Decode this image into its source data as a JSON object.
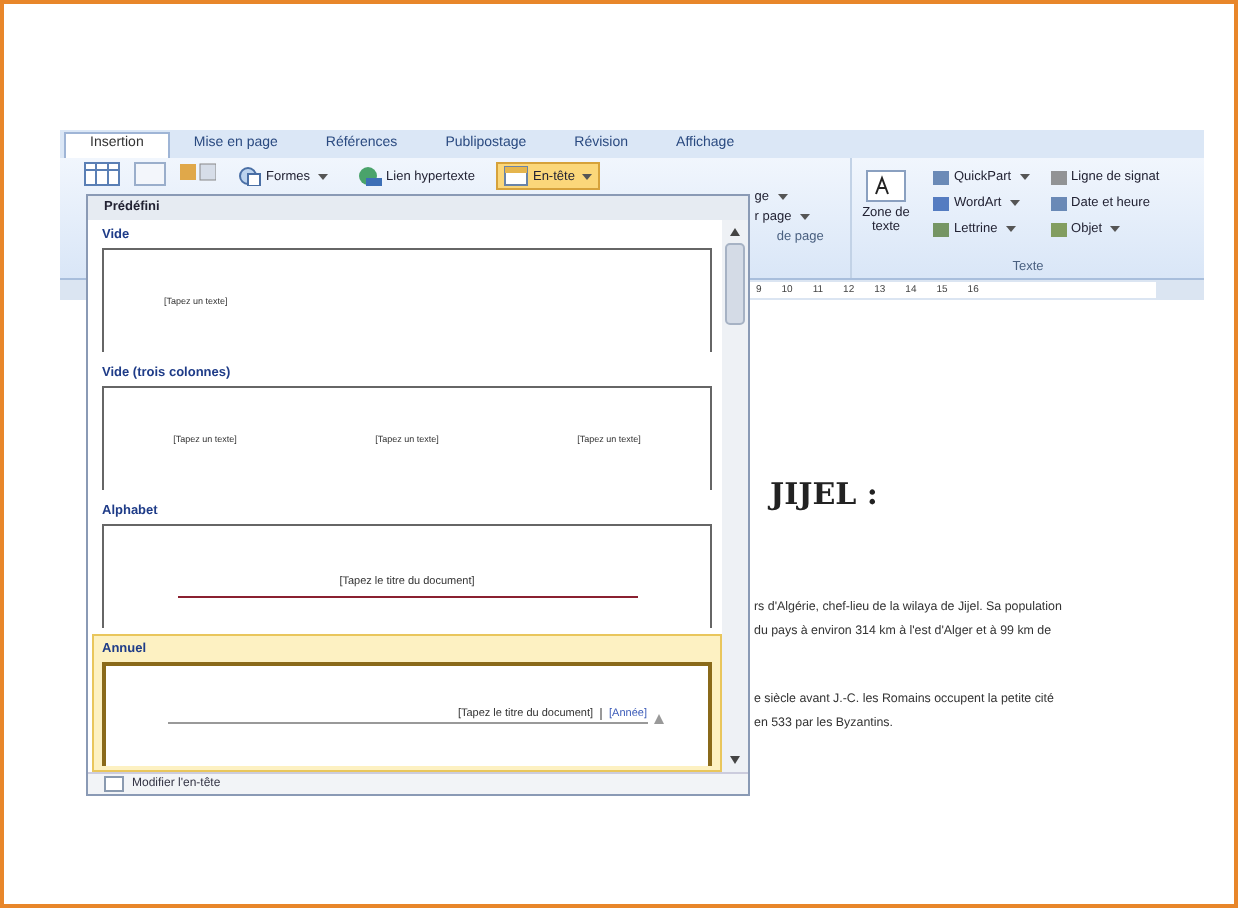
{
  "tabs": [
    {
      "label": "Insertion",
      "selected": true
    },
    {
      "label": "Mise en page",
      "selected": false
    },
    {
      "label": "Références",
      "selected": false
    },
    {
      "label": "Publipostage",
      "selected": false
    },
    {
      "label": "Révision",
      "selected": false
    },
    {
      "label": "Affichage",
      "selected": false
    }
  ],
  "ribbon": {
    "top_buttons": [
      {
        "label": "Formes",
        "has_menu": true,
        "selected": false
      },
      {
        "label": "Lien hypertexte",
        "has_menu": false,
        "selected": false
      },
      {
        "label": "En-tête",
        "has_menu": true,
        "selected": true
      }
    ],
    "cut_items": [
      {
        "label": "ge",
        "has_menu": true
      },
      {
        "label": "r page",
        "has_menu": true
      }
    ],
    "cut_group_label": "de page",
    "text_group": {
      "label": "Texte",
      "big_button": "Zone de texte",
      "items": [
        {
          "label": "QuickPart",
          "has_menu": true
        },
        {
          "label": "WordArt",
          "has_menu": true
        },
        {
          "label": "Lettrine",
          "has_menu": true
        },
        {
          "label": "Ligne de signat",
          "has_menu": false
        },
        {
          "label": "Date et heure",
          "has_menu": false
        },
        {
          "label": "Objet",
          "has_menu": true
        }
      ]
    }
  },
  "ruler": {
    "ticks": [
      "9",
      "10",
      "11",
      "12",
      "13",
      "14",
      "15",
      "16"
    ]
  },
  "gallery": {
    "title": "Prédéfini",
    "sections": [
      {
        "label": "Vide",
        "kind": "blank",
        "selected": false,
        "placeholders": [
          "[Tapez un texte]"
        ]
      },
      {
        "label": "Vide (trois colonnes)",
        "kind": "blank",
        "selected": false,
        "placeholders": [
          "[Tapez un texte]",
          "[Tapez un texte]",
          "[Tapez un texte]"
        ]
      },
      {
        "label": "Alphabet",
        "kind": "title_rule",
        "selected": false,
        "title": "[Tapez le titre du document]"
      },
      {
        "label": "Annuel",
        "kind": "title_year",
        "selected": true,
        "title": "[Tapez le titre du document]",
        "year": "[Année]"
      }
    ],
    "footer": "Modifier l'en-tête"
  },
  "document": {
    "heading": "JIJEL :",
    "paragraphs": [
      [
        "rs d'Algérie, chef-lieu de la wilaya de Jijel. Sa population",
        "du pays à environ 314 km à l'est d'Alger et à 99 km de"
      ],
      [
        "e siècle avant J.-C. les Romains occupent la petite cité",
        "en 533 par les Byzantins."
      ]
    ]
  }
}
